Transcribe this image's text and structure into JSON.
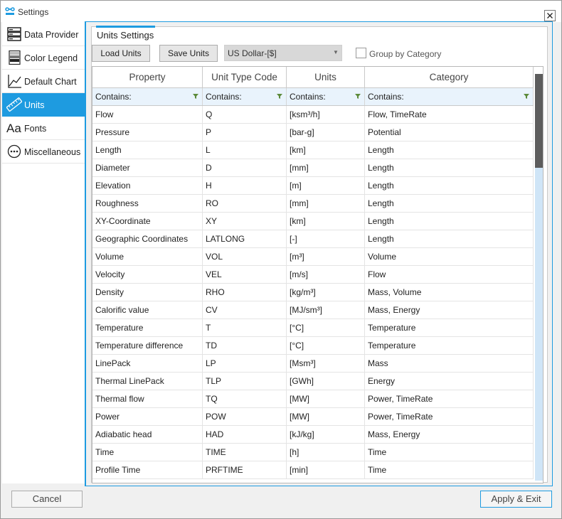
{
  "window": {
    "title": "Settings"
  },
  "sidebar": {
    "items": [
      {
        "label": "Data Provider",
        "icon": "data-provider-icon",
        "active": false
      },
      {
        "label": "Color Legend",
        "icon": "color-legend-icon",
        "active": false
      },
      {
        "label": "Default Chart",
        "icon": "chart-icon",
        "active": false
      },
      {
        "label": "Units",
        "icon": "ruler-icon",
        "active": true
      },
      {
        "label": "Fonts",
        "icon": "font-icon",
        "active": false
      },
      {
        "label": "Miscellaneous",
        "icon": "more-icon",
        "active": false
      }
    ]
  },
  "panel": {
    "title": "Units Settings",
    "load_label": "Load Units",
    "save_label": "Save Units",
    "currency": "US Dollar-[$]",
    "group_by_label": "Group by Category",
    "group_by_checked": false
  },
  "grid": {
    "columns": [
      "Property",
      "Unit Type Code",
      "Units",
      "Category"
    ],
    "filter_text": "Contains:",
    "rows": [
      [
        "Flow",
        "Q",
        "[ksm³/h]",
        "Flow, TimeRate"
      ],
      [
        "Pressure",
        "P",
        "[bar-g]",
        "Potential"
      ],
      [
        "Length",
        "L",
        "[km]",
        "Length"
      ],
      [
        "Diameter",
        "D",
        "[mm]",
        "Length"
      ],
      [
        "Elevation",
        "H",
        "[m]",
        "Length"
      ],
      [
        "Roughness",
        "RO",
        "[mm]",
        "Length"
      ],
      [
        "XY-Coordinate",
        "XY",
        "[km]",
        "Length"
      ],
      [
        "Geographic Coordinates",
        "LATLONG",
        "[-]",
        "Length"
      ],
      [
        "Volume",
        "VOL",
        "[m³]",
        "Volume"
      ],
      [
        "Velocity",
        "VEL",
        "[m/s]",
        "Flow"
      ],
      [
        "Density",
        "RHO",
        "[kg/m³]",
        "Mass, Volume"
      ],
      [
        "Calorific value",
        "CV",
        "[MJ/sm³]",
        "Mass, Energy"
      ],
      [
        "Temperature",
        "T",
        "[°C]",
        "Temperature"
      ],
      [
        "Temperature difference",
        "TD",
        "[°C]",
        "Temperature"
      ],
      [
        "LinePack",
        "LP",
        "[Msm³]",
        "Mass"
      ],
      [
        "Thermal LinePack",
        "TLP",
        "[GWh]",
        "Energy"
      ],
      [
        "Thermal flow",
        "TQ",
        "[MW]",
        "Power, TimeRate"
      ],
      [
        "Power",
        "POW",
        "[MW]",
        "Power, TimeRate"
      ],
      [
        "Adiabatic head",
        "HAD",
        "[kJ/kg]",
        "Mass, Energy"
      ],
      [
        "Time",
        "TIME",
        "[h]",
        "Time"
      ],
      [
        "Profile Time",
        "PRFTIME",
        "[min]",
        "Time"
      ]
    ]
  },
  "footer": {
    "cancel_label": "Cancel",
    "apply_label": "Apply & Exit"
  },
  "colors": {
    "accent": "#1e9be0",
    "filter_row": "#e9f3fc",
    "funnel": "#5c8a3a",
    "scroll_thumb": "#5d5d5d"
  }
}
